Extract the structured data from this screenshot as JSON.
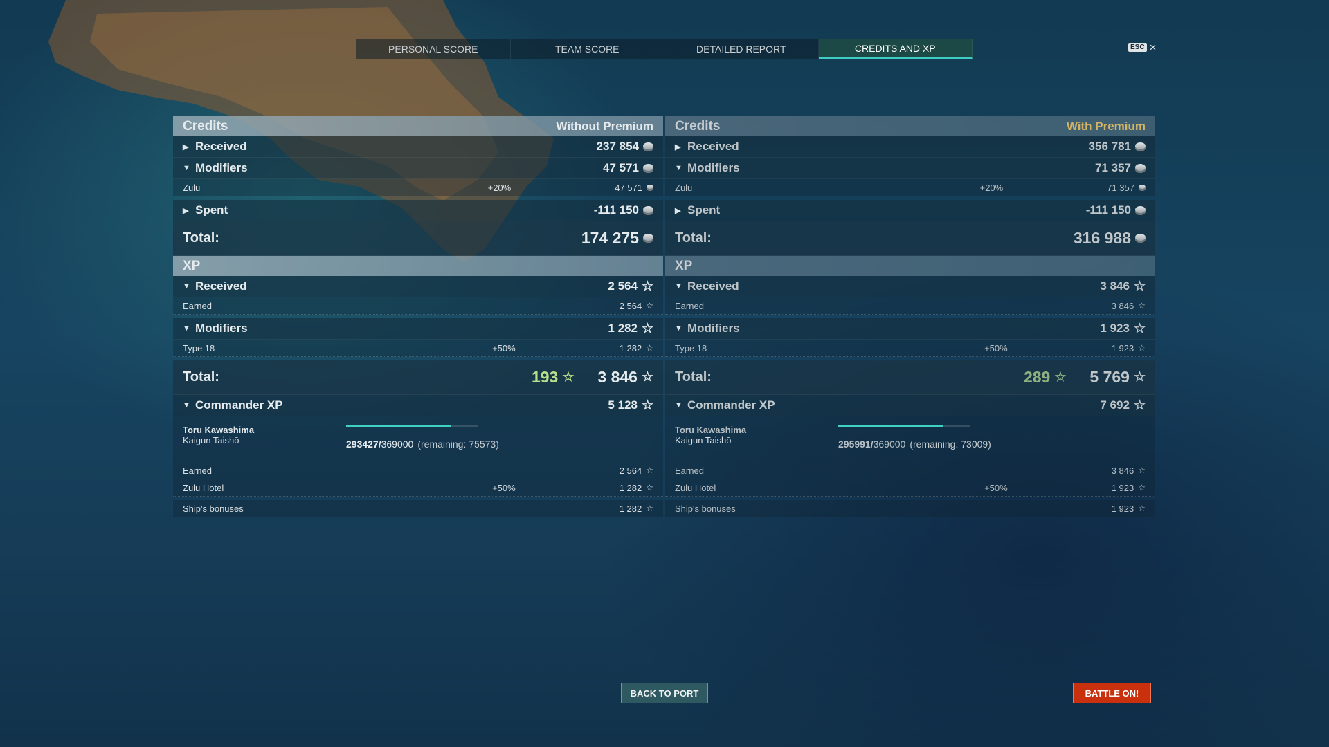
{
  "tabs": [
    "PERSONAL SCORE",
    "TEAM SCORE",
    "DETAILED REPORT",
    "CREDITS AND XP"
  ],
  "esc": {
    "key": "ESC",
    "close": "×"
  },
  "panels": [
    {
      "credits_title": "Credits",
      "premium_label": "Without Premium",
      "received": {
        "label": "Received",
        "value": "237 854"
      },
      "modifiers": {
        "label": "Modifiers",
        "value": "47 571"
      },
      "modifier_row": {
        "label": "Zulu",
        "pct": "+20%",
        "value": "47 571"
      },
      "spent": {
        "label": "Spent",
        "value": "-111 150"
      },
      "credits_total": {
        "label": "Total:",
        "value": "174 275"
      },
      "xp_title": "XP",
      "xp_received": {
        "label": "Received",
        "value": "2 564"
      },
      "earned": {
        "label": "Earned",
        "value": "2 564"
      },
      "xp_modifiers": {
        "label": "Modifiers",
        "value": "1 282"
      },
      "xp_mod_row": {
        "label": "Type 18",
        "pct": "+50%",
        "value": "1 282"
      },
      "xp_total": {
        "label": "Total:",
        "free": "193",
        "value": "3 846"
      },
      "commander": {
        "label": "Commander XP",
        "value": "5 128",
        "name": "Toru Kawashima",
        "rank": "Kaigun Taishō",
        "current": "293427/",
        "max": "369000",
        "remaining": "(remaining: 75573)",
        "progress": 0.795
      },
      "cmd_earned": {
        "label": "Earned",
        "value": "2 564"
      },
      "cmd_hotel": {
        "label": "Zulu Hotel",
        "pct": "+50%",
        "value": "1 282"
      },
      "cmd_bonus": {
        "label": "Ship's bonuses",
        "value": "1 282"
      }
    },
    {
      "credits_title": "Credits",
      "premium_label": "With Premium",
      "received": {
        "label": "Received",
        "value": "356 781"
      },
      "modifiers": {
        "label": "Modifiers",
        "value": "71 357"
      },
      "modifier_row": {
        "label": "Zulu",
        "pct": "+20%",
        "value": "71 357"
      },
      "spent": {
        "label": "Spent",
        "value": "-111 150"
      },
      "credits_total": {
        "label": "Total:",
        "value": "316 988"
      },
      "xp_title": "XP",
      "xp_received": {
        "label": "Received",
        "value": "3 846"
      },
      "earned": {
        "label": "Earned",
        "value": "3 846"
      },
      "xp_modifiers": {
        "label": "Modifiers",
        "value": "1 923"
      },
      "xp_mod_row": {
        "label": "Type 18",
        "pct": "+50%",
        "value": "1 923"
      },
      "xp_total": {
        "label": "Total:",
        "free": "289",
        "value": "5 769"
      },
      "commander": {
        "label": "Commander XP",
        "value": "7 692",
        "name": "Toru Kawashima",
        "rank": "Kaigun Taishō",
        "current": "295991/",
        "max": "369000",
        "remaining": "(remaining: 73009)",
        "progress": 0.802
      },
      "cmd_earned": {
        "label": "Earned",
        "value": "3 846"
      },
      "cmd_hotel": {
        "label": "Zulu Hotel",
        "pct": "+50%",
        "value": "1 923"
      },
      "cmd_bonus": {
        "label": "Ship's bonuses",
        "value": "1 923"
      }
    }
  ],
  "buttons": {
    "back": "BACK TO PORT",
    "battle": "BATTLE ON!"
  },
  "colors": {
    "accent": "#3ecdc0",
    "battle": "#c9300d",
    "premium": "#d3b466",
    "free_xp": "#b8df8a"
  }
}
